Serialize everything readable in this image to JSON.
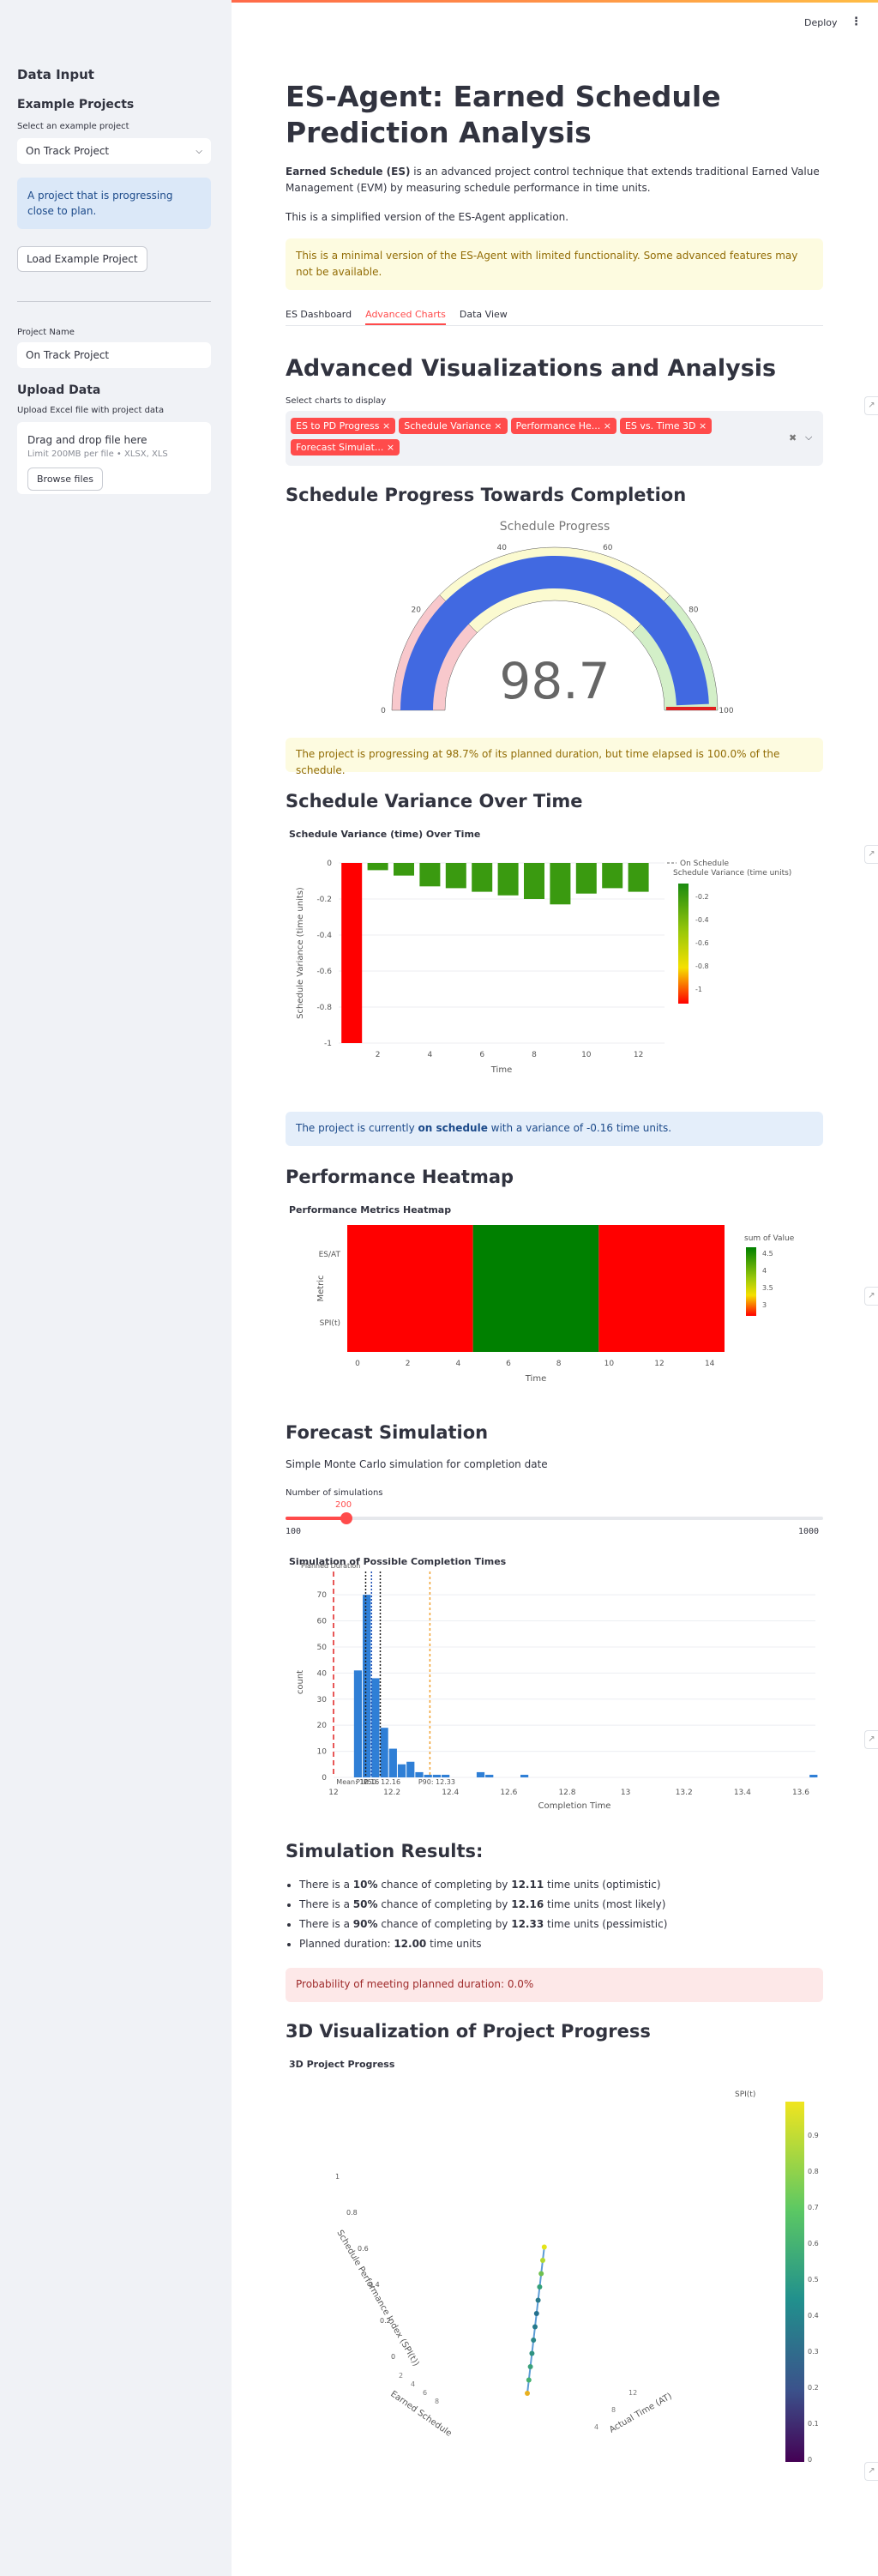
{
  "header": {
    "deploy": "Deploy",
    "menu": "⋮"
  },
  "sidebar": {
    "title": "Data Input",
    "example_heading": "Example Projects",
    "select_label": "Select an example project",
    "select_value": "On Track Project",
    "info": "A project that is progressing close to plan.",
    "load_button": "Load Example Project",
    "project_name_label": "Project Name",
    "project_name_value": "On Track Project",
    "upload_heading": "Upload Data",
    "upload_label": "Upload Excel file with project data",
    "drop_title": "Drag and drop file here",
    "drop_limit": "Limit 200MB per file • XLSX, XLS",
    "browse_button": "Browse files"
  },
  "main": {
    "title": "ES-Agent: Earned Schedule Prediction Analysis",
    "intro_bold": "Earned Schedule (ES)",
    "intro_rest": " is an advanced project control technique that extends traditional Earned Value Management (EVM) by measuring schedule performance in time units.",
    "simplified": "This is a simplified version of the ES-Agent application.",
    "warning": "This is a minimal version of the ES-Agent with limited functionality. Some advanced features may not be available.",
    "tabs": [
      "ES Dashboard",
      "Advanced Charts",
      "Data View"
    ],
    "adv_title": "Advanced Visualizations and Analysis",
    "select_charts_label": "Select charts to display",
    "chips": [
      "ES to PD Progress",
      "Schedule Variance",
      "Performance He...",
      "ES vs. Time 3D",
      "Forecast Simulat..."
    ],
    "progress_title": "Schedule Progress Towards Completion",
    "progress_msg": "The project is progressing at 98.7% of its planned duration, but time elapsed is 100.0% of the schedule.",
    "sv_title": "Schedule Variance Over Time",
    "sv_msg_a": "The project is currently ",
    "sv_msg_b": "on schedule",
    "sv_msg_c": " with a variance of -0.16 time units.",
    "heat_title": "Performance Heatmap",
    "forecast_title": "Forecast Simulation",
    "forecast_sub": "Simple Monte Carlo simulation for completion date",
    "sims_label": "Number of simulations",
    "sims_value": "200",
    "sims_min": "100",
    "sims_max": "1000",
    "results_title": "Simulation Results:",
    "results": [
      {
        "a": "There is a ",
        "b": "10%",
        "c": " chance of completing by ",
        "d": "12.11",
        "e": " time units (optimistic)"
      },
      {
        "a": "There is a ",
        "b": "50%",
        "c": " chance of completing by ",
        "d": "12.16",
        "e": " time units (most likely)"
      },
      {
        "a": "There is a ",
        "b": "90%",
        "c": " chance of completing by ",
        "d": "12.33",
        "e": " time units (pessimistic)"
      }
    ],
    "planned_a": "Planned duration: ",
    "planned_b": "12.00",
    "planned_c": " time units",
    "prob_msg": "Probability of meeting planned duration: 0.0%",
    "viz3d_title": "3D Visualization of Project Progress"
  },
  "chart_data": [
    {
      "type": "gauge",
      "title": "Schedule Progress",
      "value": 98.7,
      "range": [
        0,
        100
      ],
      "ticks": [
        "0",
        "20",
        "40",
        "60",
        "80",
        "100"
      ],
      "bands": [
        {
          "from": 0,
          "to": 25,
          "color": "#f8c8cc"
        },
        {
          "from": 25,
          "to": 75,
          "color": "#fbfad0"
        },
        {
          "from": 75,
          "to": 100,
          "color": "#d3efc8"
        }
      ],
      "bar_color": "#4169e1",
      "threshold": 100,
      "threshold_color": "#e02020"
    },
    {
      "type": "bar",
      "title": "Schedule Variance (time) Over Time",
      "xlabel": "Time",
      "ylabel": "Schedule Variance (time units)",
      "x": [
        1,
        2,
        3,
        4,
        5,
        6,
        7,
        8,
        9,
        10,
        11,
        12
      ],
      "values": [
        -1.0,
        -0.04,
        -0.07,
        -0.13,
        -0.14,
        -0.16,
        -0.18,
        -0.2,
        -0.23,
        -0.17,
        -0.14,
        -0.16
      ],
      "ylim": [
        -1,
        0
      ],
      "yticks": [
        "0",
        "-0.2",
        "-0.4",
        "-0.6",
        "-0.8",
        "-1"
      ],
      "xticks": [
        "2",
        "4",
        "6",
        "8",
        "10",
        "12"
      ],
      "legend": "On Schedule",
      "colorbar_title": "Schedule Variance (time units)",
      "colorbar_ticks": [
        "-0.2",
        "-0.4",
        "-0.6",
        "-0.8",
        "-1"
      ]
    },
    {
      "type": "heatmap",
      "title": "Performance Metrics Heatmap",
      "xlabel": "Time",
      "ylabel": "Metric",
      "rows": [
        "ES/AT",
        "SPI(t)"
      ],
      "x_ranges": [
        [
          0,
          5
        ],
        [
          5,
          10
        ],
        [
          10,
          15
        ]
      ],
      "colors": [
        "#ff0000",
        "#008000",
        "#ff0000"
      ],
      "xticks": [
        "0",
        "2",
        "4",
        "6",
        "8",
        "10",
        "12",
        "14"
      ],
      "colorbar_title": "sum of Value",
      "colorbar_ticks": [
        "4.5",
        "4",
        "3.5",
        "3"
      ]
    },
    {
      "type": "bar",
      "title": "Simulation of Possible Completion Times",
      "xlabel": "Completion Time",
      "ylabel": "count",
      "bins": [
        12.07,
        12.1,
        12.13,
        12.16,
        12.19,
        12.22,
        12.25,
        12.28,
        12.31,
        12.34,
        12.37,
        12.4,
        12.43,
        12.46,
        12.49,
        12.52,
        12.55,
        12.58,
        12.61,
        12.64,
        12.67,
        12.7,
        12.73,
        12.76,
        12.79,
        12.82,
        12.85,
        12.88,
        12.91,
        12.94,
        12.97,
        13.0,
        13.03,
        13.06,
        13.09,
        13.12,
        13.15,
        13.18,
        13.21,
        13.24,
        13.27,
        13.3,
        13.33,
        13.36,
        13.39,
        13.42,
        13.45,
        13.48,
        13.51,
        13.54,
        13.57,
        13.6,
        13.63
      ],
      "counts": [
        41,
        70,
        38,
        19,
        11,
        5,
        6,
        2,
        1,
        1,
        1,
        0,
        0,
        0,
        2,
        1,
        0,
        0,
        0,
        1,
        0,
        0,
        0,
        0,
        0,
        0,
        0,
        0,
        0,
        0,
        0,
        0,
        0,
        0,
        0,
        0,
        0,
        0,
        0,
        0,
        0,
        0,
        0,
        0,
        0,
        0,
        0,
        0,
        0,
        0,
        0,
        0,
        1
      ],
      "bin_width": 0.03,
      "xlim": [
        12.0,
        13.65
      ],
      "ylim": [
        0,
        73
      ],
      "xticks": [
        "12",
        "12.2",
        "12.4",
        "12.6",
        "12.8",
        "13",
        "13.2",
        "13.4",
        "13.6"
      ],
      "yticks": [
        "0",
        "10",
        "20",
        "30",
        "40",
        "50",
        "60",
        "70"
      ],
      "lines": [
        {
          "x": 12.0,
          "label": "Planned Duration",
          "color": "#e02020"
        },
        {
          "x": 12.11,
          "label": "P10",
          "color": "#222"
        },
        {
          "x": 12.13,
          "label": "Mean: 12.16",
          "color": "#1f4fb4"
        },
        {
          "x": 12.16,
          "label": "P50: 12.16",
          "color": "#222"
        },
        {
          "x": 12.33,
          "label": "P90: 12.33",
          "color": "#f0a030"
        }
      ]
    },
    {
      "type": "scatter3d",
      "title": "3D Project Progress",
      "axes": [
        "Earned Schedule",
        "Schedule Performance Index (SPI(t))",
        "Actual Time (AT)"
      ],
      "colorbar_title": "SPI(t)",
      "colorbar_ticks": [
        "0.9",
        "0.8",
        "0.7",
        "0.6",
        "0.5",
        "0.4",
        "0.3",
        "0.2",
        "0.1",
        "0"
      ],
      "spi_ticks": [
        "1",
        "0.8",
        "0.6",
        "0.4",
        "0.2",
        "0"
      ]
    }
  ]
}
